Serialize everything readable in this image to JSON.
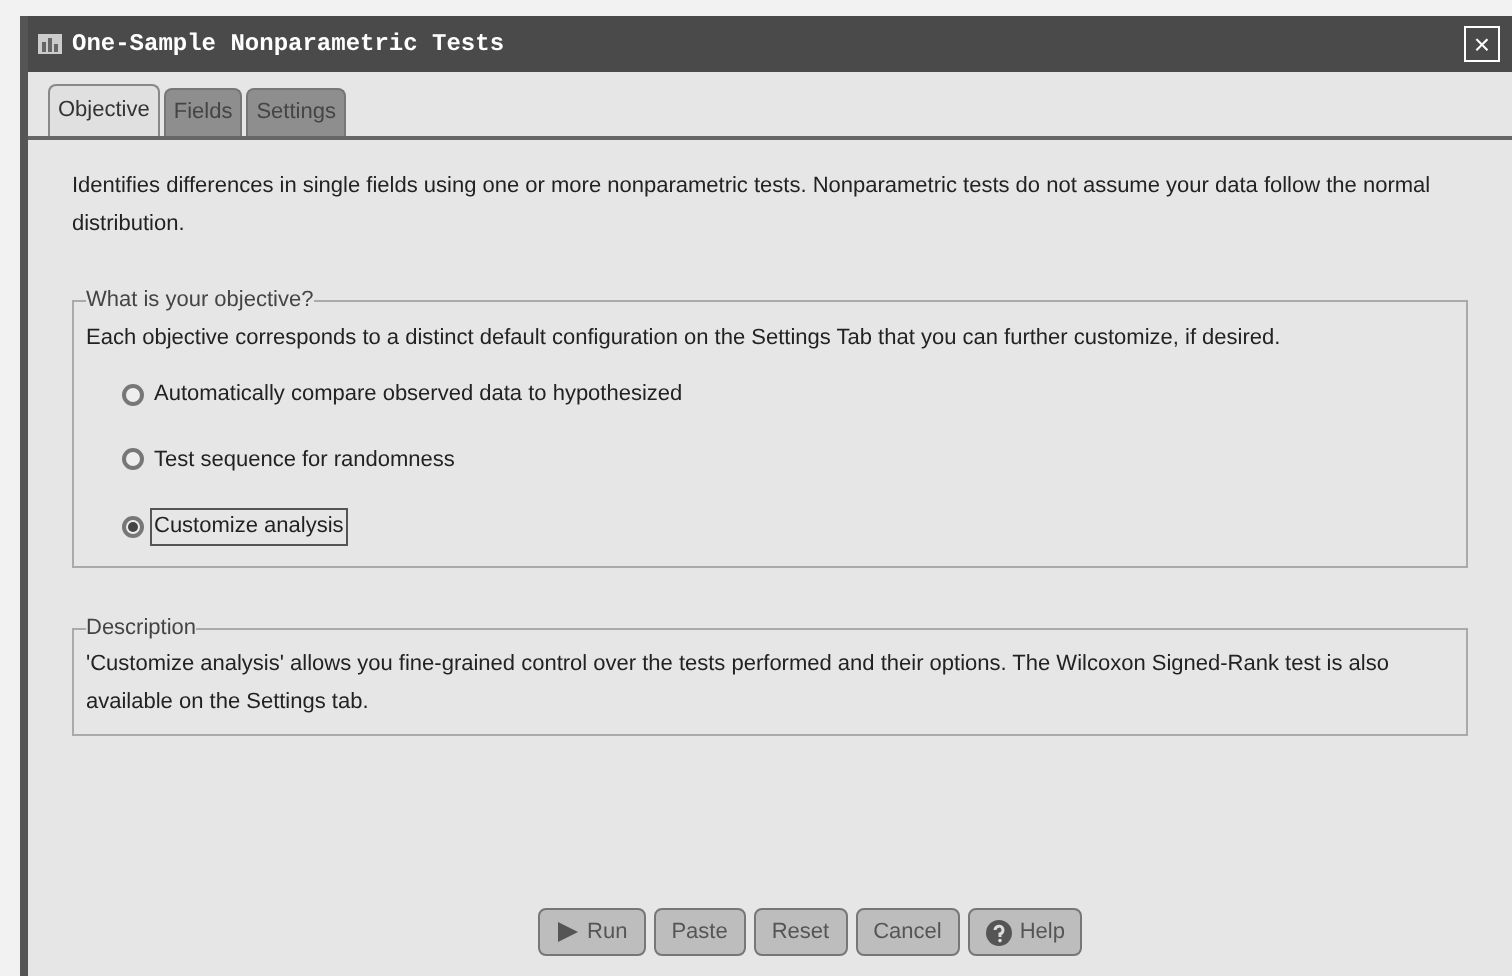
{
  "window": {
    "title": "One-Sample Nonparametric Tests",
    "close": "×"
  },
  "tabs": [
    {
      "label": "Objective",
      "selected": true
    },
    {
      "label": "Fields",
      "selected": false
    },
    {
      "label": "Settings",
      "selected": false
    }
  ],
  "intro": "Identifies differences in single fields using one or more nonparametric tests. Nonparametric tests do not assume your data follow the normal distribution.",
  "objective": {
    "legend": "What is your objective?",
    "text": "Each objective corresponds to a distinct default configuration on the Settings Tab that you can further customize, if desired.",
    "options": [
      {
        "label": "Automatically compare observed data to hypothesized",
        "selected": false
      },
      {
        "label": "Test sequence for randomness",
        "selected": false
      },
      {
        "label": "Customize analysis",
        "selected": true
      }
    ]
  },
  "description": {
    "legend": "Description",
    "text": "'Customize analysis' allows you fine-grained control over the tests performed and their options.  The Wilcoxon Signed-Rank test is also available on the Settings tab."
  },
  "buttons": [
    {
      "label": "Run",
      "kind": "run"
    },
    {
      "label": "Paste",
      "kind": "plain"
    },
    {
      "label": "Reset",
      "kind": "plain"
    },
    {
      "label": "Cancel",
      "kind": "plain"
    },
    {
      "label": "Help",
      "kind": "help"
    }
  ]
}
